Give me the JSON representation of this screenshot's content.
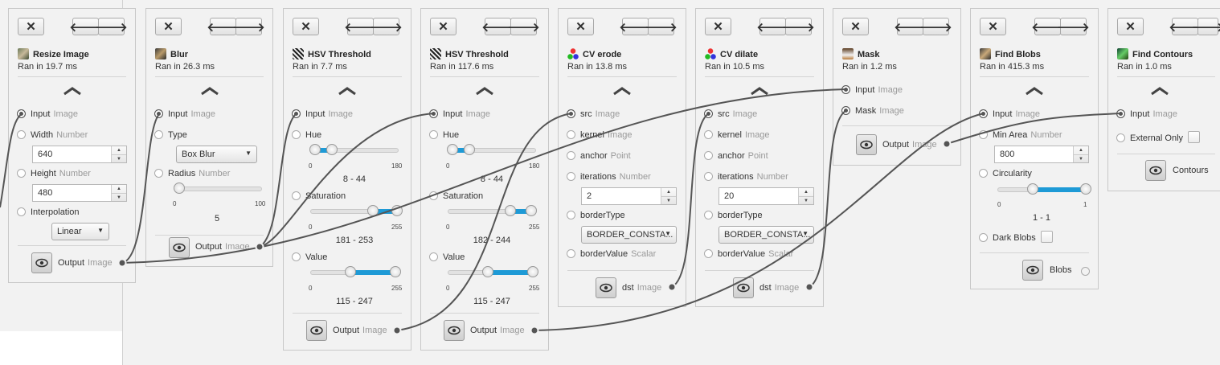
{
  "buttons": {
    "close": "✕",
    "left": "🡐",
    "right": "🡒"
  },
  "operations": [
    {
      "title": "Resize Image",
      "ran": "Ran in 19.7 ms",
      "icon": "resize-image-icon"
    },
    {
      "title": "Blur",
      "ran": "Ran in 26.3 ms",
      "icon": "blur-icon"
    },
    {
      "title": "HSV Threshold",
      "ran": "Ran in 7.7 ms",
      "icon": "hsv-threshold-icon"
    },
    {
      "title": "HSV Threshold",
      "ran": "Ran in 117.6 ms",
      "icon": "hsv-threshold-icon"
    },
    {
      "title": "CV erode",
      "ran": "Ran in 13.8 ms",
      "icon": "opencv-icon"
    },
    {
      "title": "CV dilate",
      "ran": "Ran in 10.5 ms",
      "icon": "opencv-icon"
    },
    {
      "title": "Mask",
      "ran": "Ran in 1.2 ms",
      "icon": "mask-icon"
    },
    {
      "title": "Find Blobs",
      "ran": "Ran in 415.3 ms",
      "icon": "find-blobs-icon"
    },
    {
      "title": "Find Contours",
      "ran": "Ran in 1.0 ms",
      "icon": "find-contours-icon"
    }
  ],
  "resize": {
    "input": "Input",
    "input_type": "Image",
    "width": "Width",
    "width_type": "Number",
    "width_value": "640",
    "height": "Height",
    "height_type": "Number",
    "height_value": "480",
    "interpolation": "Interpolation",
    "interpolation_value": "Linear",
    "output": "Output",
    "output_type": "Image"
  },
  "blur": {
    "input": "Input",
    "input_type": "Image",
    "type": "Type",
    "type_value": "Box Blur",
    "radius": "Radius",
    "radius_type": "Number",
    "radius_min": "0",
    "radius_max": "100",
    "radius_value": "5",
    "radius_fraction": 0.05,
    "output": "Output",
    "output_type": "Image"
  },
  "hsv1": {
    "input": "Input",
    "input_type": "Image",
    "hue": "Hue",
    "hue_min": "0",
    "hue_max": "180",
    "hue_range": "8 - 44",
    "hue_lo": 8,
    "hue_hi": 44,
    "hue_scale": 180,
    "sat": "Saturation",
    "sat_min": "0",
    "sat_max": "255",
    "sat_range": "181 - 253",
    "sat_lo": 181,
    "sat_hi": 253,
    "sat_scale": 255,
    "val": "Value",
    "val_min": "0",
    "val_max": "255",
    "val_range": "115 - 247",
    "val_lo": 115,
    "val_hi": 247,
    "val_scale": 255,
    "output": "Output",
    "output_type": "Image"
  },
  "hsv2": {
    "input": "Input",
    "input_type": "Image",
    "hue": "Hue",
    "hue_min": "0",
    "hue_max": "180",
    "hue_range": "8 - 44",
    "hue_lo": 8,
    "hue_hi": 44,
    "hue_scale": 180,
    "sat": "Saturation",
    "sat_min": "0",
    "sat_max": "255",
    "sat_range": "182 - 244",
    "sat_lo": 182,
    "sat_hi": 244,
    "sat_scale": 255,
    "val": "Value",
    "val_min": "0",
    "val_max": "255",
    "val_range": "115 - 247",
    "val_lo": 115,
    "val_hi": 247,
    "val_scale": 255,
    "output": "Output",
    "output_type": "Image"
  },
  "erode": {
    "src": "src",
    "src_type": "Image",
    "kernel": "kernel",
    "kernel_type": "Image",
    "anchor": "anchor",
    "anchor_type": "Point",
    "iterations": "iterations",
    "iterations_type": "Number",
    "iterations_value": "2",
    "border_type": "borderType",
    "border_type_value": "BORDER_CONSTA...",
    "border_value": "borderValue",
    "border_value_type": "Scalar",
    "dst": "dst",
    "dst_type": "Image"
  },
  "dilate": {
    "src": "src",
    "src_type": "Image",
    "kernel": "kernel",
    "kernel_type": "Image",
    "anchor": "anchor",
    "anchor_type": "Point",
    "iterations": "iterations",
    "iterations_type": "Number",
    "iterations_value": "20",
    "border_type": "borderType",
    "border_type_value": "BORDER_CONSTA...",
    "border_value": "borderValue",
    "border_value_type": "Scalar",
    "dst": "dst",
    "dst_type": "Image"
  },
  "mask": {
    "input": "Input",
    "input_type": "Image",
    "mask": "Mask",
    "mask_type": "Image",
    "output": "Output",
    "output_type": "Image"
  },
  "blobs": {
    "input": "Input",
    "input_type": "Image",
    "min_area": "Min Area",
    "min_area_type": "Number",
    "min_area_value": "800",
    "circularity": "Circularity",
    "circ_min": "0",
    "circ_max": "1",
    "circ_range": "1 - 1",
    "circ_lo": 0.39,
    "circ_hi": 1.0,
    "dark_blobs": "Dark Blobs",
    "output": "Blobs"
  },
  "contours": {
    "input": "Input",
    "input_type": "Image",
    "external_only": "External Only",
    "output": "Contours"
  },
  "colors": {
    "accent": "#1e9ad6",
    "panel": "#f2f2f2",
    "wire": "#555555"
  }
}
